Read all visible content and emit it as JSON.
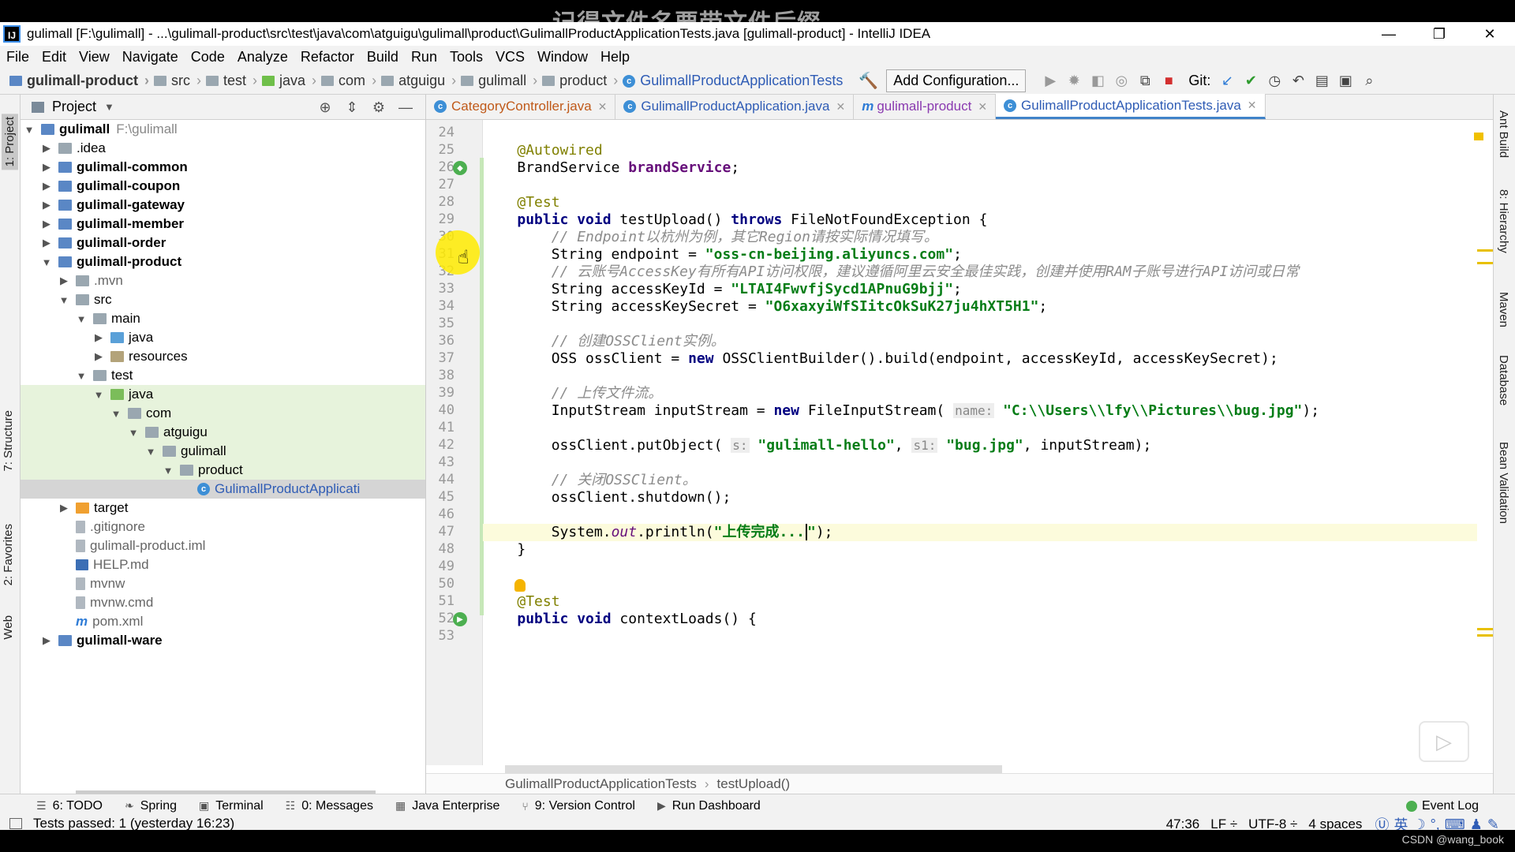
{
  "overlay": {
    "text": "记得文件名要带文件后缀",
    "watermark": "CSDN @wang_book"
  },
  "window": {
    "logo": "IJ",
    "title": "gulimall [F:\\gulimall] - ...\\gulimall-product\\src\\test\\java\\com\\atguigu\\gulimall\\product\\GulimallProductApplicationTests.java [gulimall-product] - IntelliJ IDEA",
    "minimize": "—",
    "restore": "❐",
    "close": "✕"
  },
  "menu": [
    "File",
    "Edit",
    "View",
    "Navigate",
    "Code",
    "Analyze",
    "Refactor",
    "Build",
    "Run",
    "Tools",
    "VCS",
    "Window",
    "Help"
  ],
  "navbar": {
    "crumbs": [
      "gulimall-product",
      "src",
      "test",
      "java",
      "com",
      "atguigu",
      "gulimall",
      "product",
      "GulimallProductApplicationTests"
    ],
    "add_config": "Add Configuration...",
    "git_label": "Git:"
  },
  "left_tabs": {
    "project": "1: Project",
    "structure": "7: Structure",
    "favorites": "2: Favorites",
    "web": "Web"
  },
  "project_panel": {
    "title": "Project",
    "tree": [
      {
        "label": "gulimall",
        "path": "F:\\gulimall"
      },
      {
        "label": ".idea"
      },
      {
        "label": "gulimall-common"
      },
      {
        "label": "gulimall-coupon"
      },
      {
        "label": "gulimall-gateway"
      },
      {
        "label": "gulimall-member"
      },
      {
        "label": "gulimall-order"
      },
      {
        "label": "gulimall-product"
      },
      {
        "label": ".mvn"
      },
      {
        "label": "src"
      },
      {
        "label": "main"
      },
      {
        "label": "java"
      },
      {
        "label": "resources"
      },
      {
        "label": "test"
      },
      {
        "label": "java"
      },
      {
        "label": "com"
      },
      {
        "label": "atguigu"
      },
      {
        "label": "gulimall"
      },
      {
        "label": "product"
      },
      {
        "label": "GulimallProductApplicati"
      },
      {
        "label": "target"
      },
      {
        "label": ".gitignore"
      },
      {
        "label": "gulimall-product.iml"
      },
      {
        "label": "HELP.md"
      },
      {
        "label": "mvnw"
      },
      {
        "label": "mvnw.cmd"
      },
      {
        "label": "pom.xml"
      },
      {
        "label": "gulimall-ware"
      }
    ]
  },
  "tabs": [
    {
      "label": "CategoryController.java"
    },
    {
      "label": "GulimallProductApplication.java"
    },
    {
      "label": "gulimall-product"
    },
    {
      "label": "GulimallProductApplicationTests.java"
    }
  ],
  "line_numbers": [
    "24",
    "25",
    "26",
    "27",
    "28",
    "29",
    "30",
    "31",
    "32",
    "33",
    "34",
    "35",
    "36",
    "37",
    "38",
    "39",
    "40",
    "41",
    "42",
    "43",
    "44",
    "45",
    "46",
    "47",
    "48",
    "49",
    "50",
    "51",
    "52",
    "53"
  ],
  "code": {
    "l25": "@Autowired",
    "l26a": "BrandService ",
    "l26b": "brandService",
    "l26c": ";",
    "l28": "@Test",
    "l29a": "public void ",
    "l29b": "testUpload() ",
    "l29c": "throws ",
    "l29d": "FileNotFoundException {",
    "l30": "// Endpoint以杭州为例，其它Region请按实际情况填写。",
    "l31a": "String endpoint = ",
    "l31b": "\"oss-cn-beijing.aliyuncs.com\"",
    "l31c": ";",
    "l32": "// 云账号AccessKey有所有API访问权限，建议遵循阿里云安全最佳实践，创建并使用RAM子账号进行API访问或日常",
    "l33a": "String accessKeyId = ",
    "l33b": "\"LTAI4FwvfjSycd1APnuG9bjj\"",
    "l33c": ";",
    "l34a": "String accessKeySecret = ",
    "l34b": "\"O6xaxyiWfSIitcOkSuK27ju4hXT5H1\"",
    "l34c": ";",
    "l36": "// 创建OSSClient实例。",
    "l37a": "OSS ossClient = ",
    "l37b": "new ",
    "l37c": "OSSClientBuilder().build(endpoint, accessKeyId, accessKeySecret);",
    "l39": "// 上传文件流。",
    "l40a": "InputStream inputStream = ",
    "l40b": "new ",
    "l40c": "FileInputStream( ",
    "l40hint": "name:",
    "l40d": "\"C:\\\\Users\\\\lfy\\\\Pictures\\\\bug.jpg\"",
    "l40e": ");",
    "l42a": "ossClient.putObject( ",
    "l42h1": "s:",
    "l42b": "\"gulimall-hello\"",
    "l42c": ", ",
    "l42h2": "s1:",
    "l42d": "\"bug.jpg\"",
    "l42e": ", inputStream);",
    "l44": "// 关闭OSSClient。",
    "l45": "ossClient.shutdown();",
    "l47a": "System.",
    "l47b": "out",
    "l47c": ".println(",
    "l47d": "\"上传完成...",
    "l47e": "\"",
    "l47f": ");",
    "l48": "}",
    "l51": "@Test",
    "l52a": "public void ",
    "l52b": "contextLoads() {"
  },
  "editor_breadcrumb": [
    "GulimallProductApplicationTests",
    "testUpload()"
  ],
  "right_tabs": [
    "Ant Build",
    "8: Hierarchy",
    "Maven",
    "Database",
    "Bean Validation"
  ],
  "bottom_tools": [
    "6: TODO",
    "Spring",
    "Terminal",
    "0: Messages",
    "Java Enterprise",
    "9: Version Control",
    "Run Dashboard"
  ],
  "event_log": "Event Log",
  "status": {
    "message": "Tests passed: 1 (yesterday 16:23)",
    "position": "47:36",
    "line_sep": "LF ÷",
    "encoding": "UTF-8 ÷",
    "indent": "4 spaces",
    "ime": "英"
  }
}
